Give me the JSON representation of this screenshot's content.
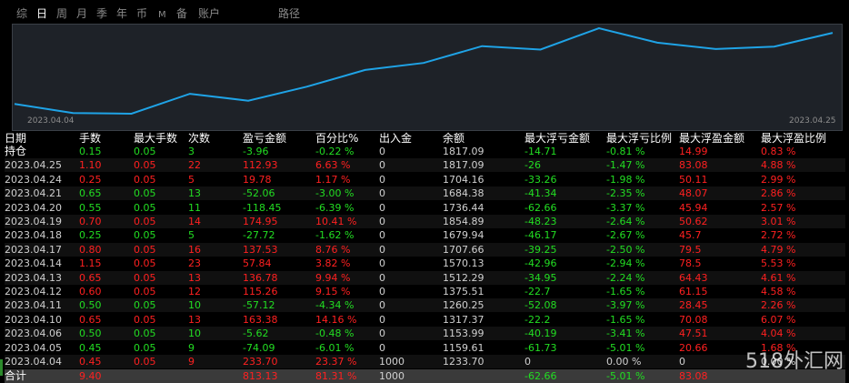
{
  "tabs": [
    "综",
    "日",
    "周",
    "月",
    "季",
    "年",
    "币",
    "M",
    "备",
    "账户",
    "路径"
  ],
  "active_tab": "日",
  "chart": {
    "start_date": "2023.04.04",
    "end_date": "2023.04.25",
    "line_color": "#1fa3e6"
  },
  "chart_data": {
    "type": "line",
    "x": [
      "2023.04.04",
      "2023.04.05",
      "2023.04.06",
      "2023.04.10",
      "2023.04.11",
      "2023.04.12",
      "2023.04.13",
      "2023.04.14",
      "2023.04.17",
      "2023.04.18",
      "2023.04.19",
      "2023.04.20",
      "2023.04.21",
      "2023.04.24",
      "2023.04.25"
    ],
    "series": [
      {
        "values": [
          1233.7,
          1159.61,
          1153.99,
          1317.37,
          1260.25,
          1375.51,
          1512.29,
          1570.13,
          1707.66,
          1679.94,
          1854.89,
          1736.44,
          1684.38,
          1704.16,
          1817.09
        ]
      }
    ]
  },
  "colors": {
    "up": "#ff2020",
    "down": "#22dd22",
    "neutral": "#d0d0d0",
    "header": "#ffffff"
  },
  "table": {
    "headers": [
      "日期",
      "手数",
      "最大手数",
      "次数",
      "盈亏金额",
      "百分比%",
      "出入金",
      "余额",
      "最大浮亏金额",
      "最大浮亏比例",
      "最大浮盈金额",
      "最大浮盈比例"
    ],
    "rows": [
      {
        "date": "持仓",
        "lots": "0.15",
        "max_lots": "0.05",
        "count": "3",
        "pnl": "-3.96",
        "pct": "-0.22 %",
        "flow": "0",
        "balance": "1817.09",
        "max_loss": "-14.71",
        "max_loss_pct": "-0.81 %",
        "max_gain": "14.99",
        "max_gain_pct": "0.83 %",
        "dir": "down"
      },
      {
        "date": "2023.04.25",
        "lots": "1.10",
        "max_lots": "0.05",
        "count": "22",
        "pnl": "112.93",
        "pct": "6.63 %",
        "flow": "0",
        "balance": "1817.09",
        "max_loss": "-26",
        "max_loss_pct": "-1.47 %",
        "max_gain": "83.08",
        "max_gain_pct": "4.88 %",
        "dir": "up"
      },
      {
        "date": "2023.04.24",
        "lots": "0.25",
        "max_lots": "0.05",
        "count": "5",
        "pnl": "19.78",
        "pct": "1.17 %",
        "flow": "0",
        "balance": "1704.16",
        "max_loss": "-33.26",
        "max_loss_pct": "-1.98 %",
        "max_gain": "50.11",
        "max_gain_pct": "2.99 %",
        "dir": "up"
      },
      {
        "date": "2023.04.21",
        "lots": "0.65",
        "max_lots": "0.05",
        "count": "13",
        "pnl": "-52.06",
        "pct": "-3.00 %",
        "flow": "0",
        "balance": "1684.38",
        "max_loss": "-41.34",
        "max_loss_pct": "-2.35 %",
        "max_gain": "48.07",
        "max_gain_pct": "2.86 %",
        "dir": "down"
      },
      {
        "date": "2023.04.20",
        "lots": "0.55",
        "max_lots": "0.05",
        "count": "11",
        "pnl": "-118.45",
        "pct": "-6.39 %",
        "flow": "0",
        "balance": "1736.44",
        "max_loss": "-62.66",
        "max_loss_pct": "-3.37 %",
        "max_gain": "45.94",
        "max_gain_pct": "2.57 %",
        "dir": "down"
      },
      {
        "date": "2023.04.19",
        "lots": "0.70",
        "max_lots": "0.05",
        "count": "14",
        "pnl": "174.95",
        "pct": "10.41 %",
        "flow": "0",
        "balance": "1854.89",
        "max_loss": "-48.23",
        "max_loss_pct": "-2.64 %",
        "max_gain": "50.62",
        "max_gain_pct": "3.01 %",
        "dir": "up"
      },
      {
        "date": "2023.04.18",
        "lots": "0.25",
        "max_lots": "0.05",
        "count": "5",
        "pnl": "-27.72",
        "pct": "-1.62 %",
        "flow": "0",
        "balance": "1679.94",
        "max_loss": "-46.17",
        "max_loss_pct": "-2.67 %",
        "max_gain": "45.7",
        "max_gain_pct": "2.72 %",
        "dir": "down"
      },
      {
        "date": "2023.04.17",
        "lots": "0.80",
        "max_lots": "0.05",
        "count": "16",
        "pnl": "137.53",
        "pct": "8.76 %",
        "flow": "0",
        "balance": "1707.66",
        "max_loss": "-39.25",
        "max_loss_pct": "-2.50 %",
        "max_gain": "79.5",
        "max_gain_pct": "4.79 %",
        "dir": "up"
      },
      {
        "date": "2023.04.14",
        "lots": "1.15",
        "max_lots": "0.05",
        "count": "23",
        "pnl": "57.84",
        "pct": "3.82 %",
        "flow": "0",
        "balance": "1570.13",
        "max_loss": "-42.96",
        "max_loss_pct": "-2.94 %",
        "max_gain": "78.5",
        "max_gain_pct": "5.53 %",
        "dir": "up"
      },
      {
        "date": "2023.04.13",
        "lots": "0.65",
        "max_lots": "0.05",
        "count": "13",
        "pnl": "136.78",
        "pct": "9.94 %",
        "flow": "0",
        "balance": "1512.29",
        "max_loss": "-34.95",
        "max_loss_pct": "-2.24 %",
        "max_gain": "64.43",
        "max_gain_pct": "4.61 %",
        "dir": "up"
      },
      {
        "date": "2023.04.12",
        "lots": "0.60",
        "max_lots": "0.05",
        "count": "12",
        "pnl": "115.26",
        "pct": "9.15 %",
        "flow": "0",
        "balance": "1375.51",
        "max_loss": "-22.7",
        "max_loss_pct": "-1.65 %",
        "max_gain": "61.15",
        "max_gain_pct": "4.58 %",
        "dir": "up"
      },
      {
        "date": "2023.04.11",
        "lots": "0.50",
        "max_lots": "0.05",
        "count": "10",
        "pnl": "-57.12",
        "pct": "-4.34 %",
        "flow": "0",
        "balance": "1260.25",
        "max_loss": "-52.08",
        "max_loss_pct": "-3.97 %",
        "max_gain": "28.45",
        "max_gain_pct": "2.26 %",
        "dir": "down"
      },
      {
        "date": "2023.04.10",
        "lots": "0.65",
        "max_lots": "0.05",
        "count": "13",
        "pnl": "163.38",
        "pct": "14.16 %",
        "flow": "0",
        "balance": "1317.37",
        "max_loss": "-22.2",
        "max_loss_pct": "-1.65 %",
        "max_gain": "70.08",
        "max_gain_pct": "6.07 %",
        "dir": "up"
      },
      {
        "date": "2023.04.06",
        "lots": "0.50",
        "max_lots": "0.05",
        "count": "10",
        "pnl": "-5.62",
        "pct": "-0.48 %",
        "flow": "0",
        "balance": "1153.99",
        "max_loss": "-40.19",
        "max_loss_pct": "-3.41 %",
        "max_gain": "47.51",
        "max_gain_pct": "4.04 %",
        "dir": "down"
      },
      {
        "date": "2023.04.05",
        "lots": "0.45",
        "max_lots": "0.05",
        "count": "9",
        "pnl": "-74.09",
        "pct": "-6.01 %",
        "flow": "0",
        "balance": "1159.61",
        "max_loss": "-61.73",
        "max_loss_pct": "-5.01 %",
        "max_gain": "20.66",
        "max_gain_pct": "1.68 %",
        "dir": "down"
      },
      {
        "date": "2023.04.04",
        "lots": "0.45",
        "max_lots": "0.05",
        "count": "9",
        "pnl": "233.70",
        "pct": "23.37 %",
        "flow": "1000",
        "balance": "1233.70",
        "max_loss": "0",
        "max_loss_pct": "0.00 %",
        "max_gain": "0",
        "max_gain_pct": "0.00 %",
        "dir": "up"
      }
    ],
    "total": {
      "date": "合计",
      "lots": "9.40",
      "max_lots": "",
      "count": "",
      "pnl": "813.13",
      "pct": "81.31 %",
      "flow": "1000",
      "balance": "",
      "max_loss": "-62.66",
      "max_loss_pct": "-5.01 %",
      "max_gain": "83.08",
      "max_gain_pct": ""
    }
  },
  "watermark": "518外汇网"
}
